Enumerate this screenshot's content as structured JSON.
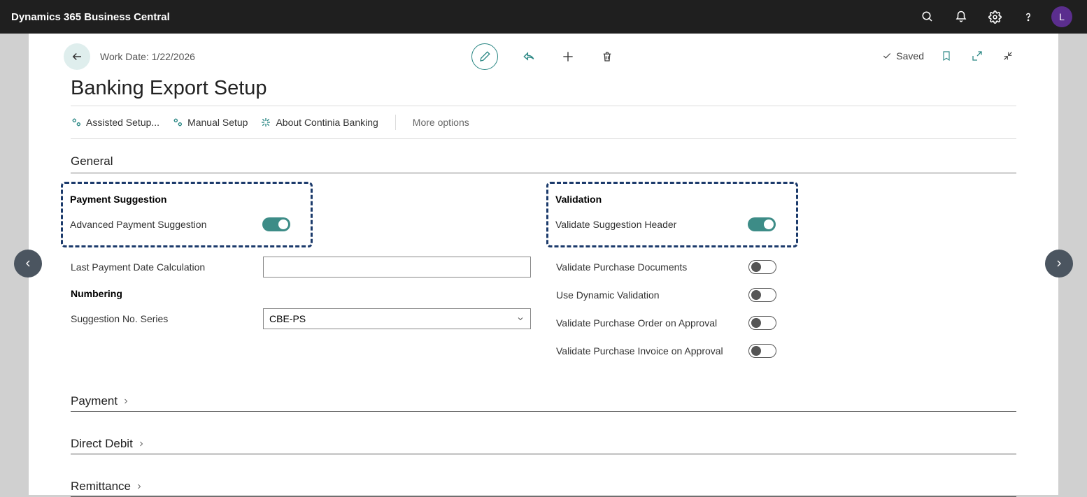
{
  "topbar": {
    "title": "Dynamics 365 Business Central",
    "avatar": "L"
  },
  "head": {
    "workdate": "Work Date: 1/22/2026",
    "pageTitle": "Banking Export Setup",
    "saved": "Saved"
  },
  "cmdbar": {
    "assisted": "Assisted Setup...",
    "manual": "Manual Setup",
    "about": "About Continia Banking",
    "more": "More options"
  },
  "general": {
    "header": "General",
    "paymentSuggestion": {
      "subhead": "Payment Suggestion",
      "advancedLabel": "Advanced Payment Suggestion",
      "advancedOn": true
    },
    "lastPaymentDateCalc": {
      "label": "Last Payment Date Calculation",
      "value": ""
    },
    "numbering": {
      "subhead": "Numbering",
      "suggestionNoSeriesLabel": "Suggestion No. Series",
      "suggestionNoSeriesValue": "CBE-PS"
    },
    "validation": {
      "subhead": "Validation",
      "rows": [
        {
          "label": "Validate Suggestion Header",
          "on": true
        },
        {
          "label": "Validate Purchase Documents",
          "on": false
        },
        {
          "label": "Use Dynamic Validation",
          "on": false
        },
        {
          "label": "Validate Purchase Order on Approval",
          "on": false
        },
        {
          "label": "Validate Purchase Invoice on Approval",
          "on": false
        }
      ]
    }
  },
  "collapsed": {
    "payment": "Payment",
    "directDebit": "Direct Debit",
    "remittance": "Remittance"
  }
}
